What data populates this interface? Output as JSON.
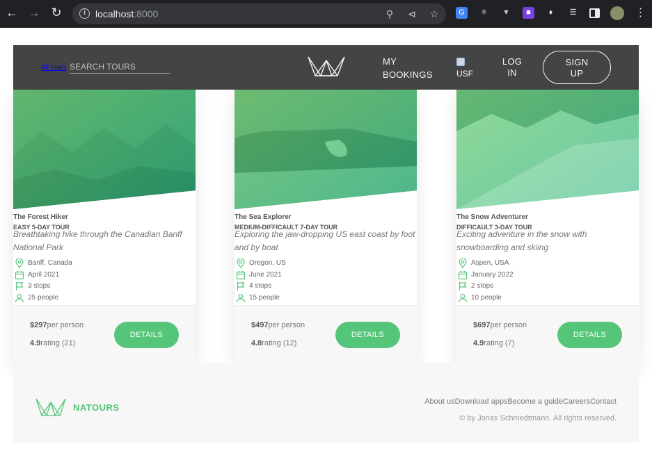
{
  "browser": {
    "url_host": "localhost",
    "url_port": ":8000"
  },
  "header": {
    "all_tours": "All tours",
    "search_placeholder": "SEARCH TOURS",
    "my_bookings_line1": "MY",
    "my_bookings_line2": "BOOKINGS",
    "user_label": "USF",
    "login_line1": "LOG",
    "login_line2": "IN",
    "signup_line1": "SIGN",
    "signup_line2": "UP"
  },
  "tours": [
    {
      "name": "The Forest Hiker",
      "subheading": "Easy 5-day tour",
      "description": "Breathtaking hike through the Canadian Banff National Park",
      "location": "Banff, Canada",
      "date": "April 2021",
      "stops": "3 stops",
      "people": "25 people",
      "price": "$297",
      "price_unit": "per person",
      "rating_value": "4.9",
      "rating_text": "rating (21)",
      "button": "DETAILS"
    },
    {
      "name": "The Sea Explorer",
      "subheading": "Medium-difficault 7-day tour",
      "description": "Exploring the jaw-dropping US east coast by foot and by boat",
      "location": "Oregon, US",
      "date": "June 2021",
      "stops": "4 stops",
      "people": "15 people",
      "price": "$497",
      "price_unit": "per person",
      "rating_value": "4.8",
      "rating_text": "rating (12)",
      "button": "DETAILS"
    },
    {
      "name": "The Snow Adventurer",
      "subheading": "Difficault 3-day tour",
      "description": "Exciting adventure in the snow with snowboarding and skiing",
      "location": "Aspen, USA",
      "date": "January 2022",
      "stops": "2 stops",
      "people": "10 people",
      "price": "$697",
      "price_unit": "per person",
      "rating_value": "4.9",
      "rating_text": "rating (7)",
      "button": "DETAILS"
    }
  ],
  "footer": {
    "brand": "NATOURS",
    "links": [
      "About us",
      "Download apps",
      "Become a guide",
      "Careers",
      "Contact"
    ],
    "copyright": "© by Jonas Schmedtmann. All rights reserved."
  },
  "colors": {
    "accent": "#55c57a",
    "header_bg": "#444444",
    "footer_bg": "#f7f7f7"
  }
}
